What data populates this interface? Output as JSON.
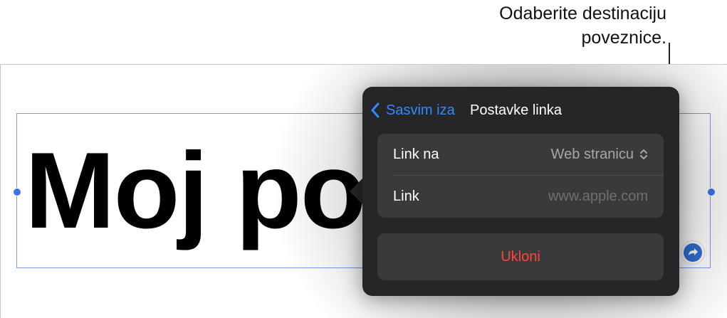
{
  "callout": {
    "line1": "Odaberite destinaciju",
    "line2": "poveznice."
  },
  "document": {
    "text": "Moj po"
  },
  "popover": {
    "back_label": "Sasvim iza",
    "title": "Postavke linka",
    "rows": [
      {
        "label": "Link na",
        "value": "Web stranicu"
      },
      {
        "label": "Link",
        "placeholder": "www.apple.com"
      }
    ],
    "remove_label": "Ukloni"
  },
  "icons": {
    "back": "chevron-left-icon",
    "popup": "chevron-up-down-icon",
    "link": "link-arrow-icon"
  },
  "colors": {
    "accent": "#2f8bff",
    "destructive": "#ff453a",
    "popover_bg": "#262628",
    "group_bg": "#3a3a3c",
    "selection": "#3f74e6"
  }
}
